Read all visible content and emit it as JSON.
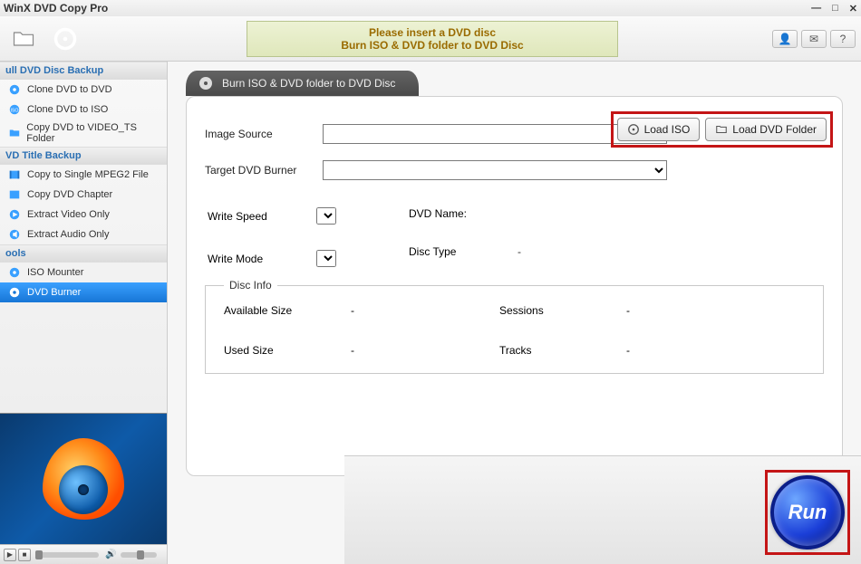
{
  "window": {
    "title": "WinX DVD Copy Pro"
  },
  "banner": {
    "line1": "Please insert a DVD disc",
    "line2": "Burn ISO & DVD folder to DVD Disc"
  },
  "sidebar": {
    "groups": [
      {
        "header": "ull DVD Disc Backup",
        "items": [
          {
            "label": "Clone DVD to DVD"
          },
          {
            "label": "Clone DVD to ISO"
          },
          {
            "label": "Copy DVD to VIDEO_TS Folder"
          }
        ]
      },
      {
        "header": "VD Title Backup",
        "items": [
          {
            "label": "Copy to Single MPEG2 File"
          },
          {
            "label": "Copy DVD Chapter"
          },
          {
            "label": "Extract Video Only"
          },
          {
            "label": "Extract Audio Only"
          }
        ]
      },
      {
        "header": "ools",
        "items": [
          {
            "label": "ISO Mounter"
          },
          {
            "label": "DVD Burner"
          }
        ]
      }
    ]
  },
  "tab": {
    "label": "Burn ISO & DVD folder to DVD Disc"
  },
  "form": {
    "image_source_label": "Image Source",
    "target_burner_label": "Target DVD Burner",
    "load_iso": "Load ISO",
    "load_folder": "Load DVD Folder",
    "write_speed_label": "Write Speed",
    "write_mode_label": "Write Mode",
    "dvd_name_label": "DVD Name:",
    "disc_type_label": "Disc Type",
    "disc_type_value": "-",
    "disc_info_legend": "Disc Info",
    "avail_size_label": "Available Size",
    "avail_size_value": "-",
    "used_size_label": "Used Size",
    "used_size_value": "-",
    "sessions_label": "Sessions",
    "sessions_value": "-",
    "tracks_label": "Tracks",
    "tracks_value": "-"
  },
  "run": {
    "label": "Run"
  }
}
